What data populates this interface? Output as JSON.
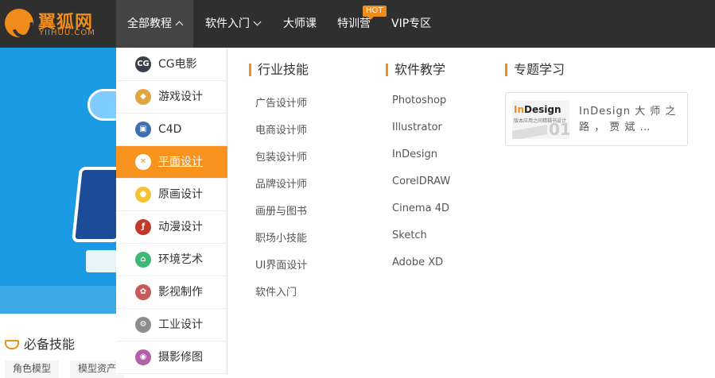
{
  "brand": {
    "name_cn": "翼狐网",
    "name_en": "YIIHUU.COM",
    "accent": "#f08c1c"
  },
  "nav": {
    "all_courses": "全部教程",
    "software_intro": "软件入门",
    "master_class": "大师课",
    "training_camp": "特训营",
    "hot_badge": "HOT",
    "vip": "VIP专区"
  },
  "categories": [
    {
      "label": "CG电影",
      "icon": "cg-icon",
      "color": "#3a3f4d"
    },
    {
      "label": "游戏设计",
      "icon": "gamepad-icon",
      "color": "#e0a53c"
    },
    {
      "label": "C4D",
      "icon": "cube-icon",
      "color": "#3c6fb0"
    },
    {
      "label": "平面设计",
      "icon": "pen-tool-icon",
      "color": "#ffffff",
      "active": true
    },
    {
      "label": "原画设计",
      "icon": "palette-icon",
      "color": "#f2c233"
    },
    {
      "label": "动漫设计",
      "icon": "flash-icon",
      "color": "#c0392b"
    },
    {
      "label": "环境艺术",
      "icon": "house-icon",
      "color": "#3cb878"
    },
    {
      "label": "影视制作",
      "icon": "film-reel-icon",
      "color": "#c85a5a"
    },
    {
      "label": "工业设计",
      "icon": "gear-icon",
      "color": "#8c8c8c"
    },
    {
      "label": "摄影修图",
      "icon": "camera-icon",
      "color": "#b25fa8"
    }
  ],
  "industry": {
    "title": "行业技能",
    "links": [
      "广告设计师",
      "电商设计师",
      "包装设计师",
      "品牌设计师",
      "画册与图书",
      "职场小技能",
      "UI界面设计",
      "软件入门"
    ]
  },
  "software": {
    "title": "软件教学",
    "links": [
      "Photoshop",
      "Illustrator",
      "InDesign",
      "CorelDRAW",
      "Cinema 4D",
      "Sketch",
      "Adobe XD"
    ]
  },
  "topics": {
    "title": "专题学习",
    "card_text": "InDesign 大 师 之 路 ， 贾 斌 …",
    "thumb_title_a": "In",
    "thumb_title_b": "Design",
    "thumb_sub": "版本应用之间精辑书设计",
    "thumb_num": "01"
  },
  "skills": {
    "title": "必备技能",
    "tags": [
      "角色模型",
      "模型资产"
    ]
  }
}
